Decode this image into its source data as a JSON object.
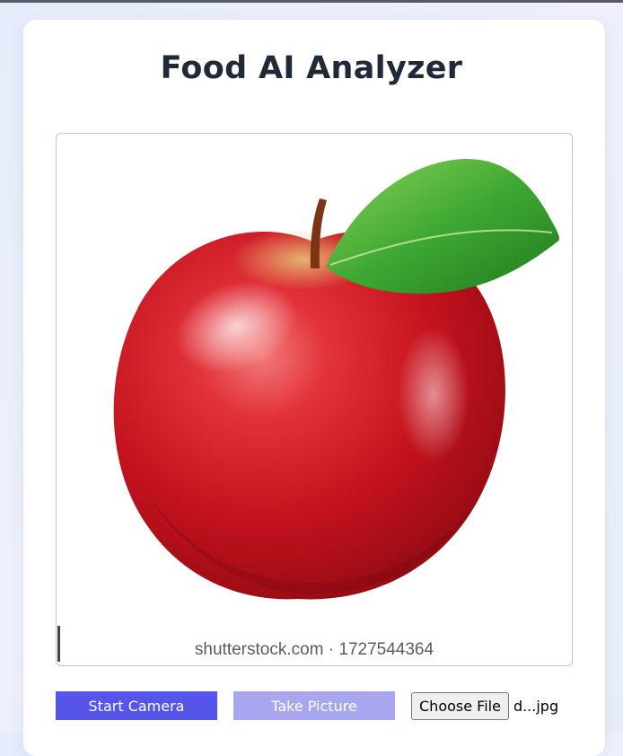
{
  "app": {
    "title": "Food AI Analyzer"
  },
  "preview": {
    "subject": "red apple with green leaf",
    "watermark": "shutterstock.com · 1727544364"
  },
  "controls": {
    "start_camera_label": "Start Camera",
    "take_picture_label": "Take Picture",
    "choose_file_label": "Choose File",
    "file_name": "d...jpg"
  },
  "colors": {
    "start_button": "#5555ea",
    "take_button_disabled": "#a7a6ef",
    "title_text": "#1f2937",
    "frame_border": "#b9c4f0"
  }
}
